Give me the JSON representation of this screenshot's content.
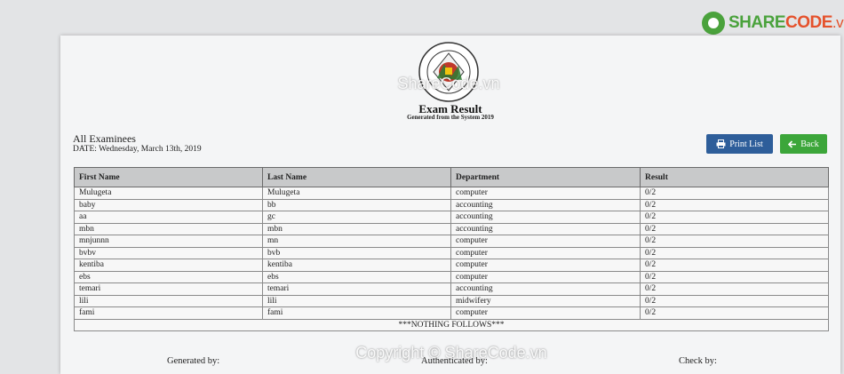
{
  "brand": {
    "name_part1": "SHARE",
    "name_part2": "CODE",
    "name_part3": ".vn"
  },
  "watermarks": {
    "top": "ShareCode.vn",
    "bottom": "Copyright © ShareCode.vn"
  },
  "header": {
    "title": "Exam Result",
    "subtitle": "Generated from the System 2019"
  },
  "list": {
    "title": "All Examinees",
    "date": "DATE: Wednesday, March 13th, 2019"
  },
  "buttons": {
    "print_label": "Print List",
    "back_label": "Back"
  },
  "table": {
    "columns": [
      "First Name",
      "Last Name",
      "Department",
      "Result"
    ],
    "rows": [
      [
        "Mulugeta",
        "Mulugeta",
        "computer",
        "0/2"
      ],
      [
        "baby",
        "bb",
        "accounting",
        "0/2"
      ],
      [
        "aa",
        "gc",
        "accounting",
        "0/2"
      ],
      [
        "mbn",
        "mbn",
        "accounting",
        "0/2"
      ],
      [
        "mnjunnn",
        "mn",
        "computer",
        "0/2"
      ],
      [
        "bvbv",
        "bvb",
        "computer",
        "0/2"
      ],
      [
        "kentiba",
        "kentiba",
        "computer",
        "0/2"
      ],
      [
        "ebs",
        "ebs",
        "computer",
        "0/2"
      ],
      [
        "temari",
        "temari",
        "accounting",
        "0/2"
      ],
      [
        "lili",
        "lili",
        "midwifery",
        "0/2"
      ],
      [
        "fami",
        "fami",
        "computer",
        "0/2"
      ]
    ],
    "footer": "***NOTHING FOLLOWS***"
  },
  "signatures": {
    "generated_by": "Generated by:",
    "authenticated_by": "Authenticated by:",
    "check_by": "Check by:"
  },
  "colors": {
    "print_button": "#2e5e9a",
    "back_button": "#3ca63a",
    "header_row": "#c8c9ca",
    "brand_green": "#4aa23c",
    "brand_orange": "#e5512b"
  },
  "icons": {
    "print": "printer-icon",
    "back": "arrow-left-icon",
    "seal": "university-seal-icon"
  }
}
